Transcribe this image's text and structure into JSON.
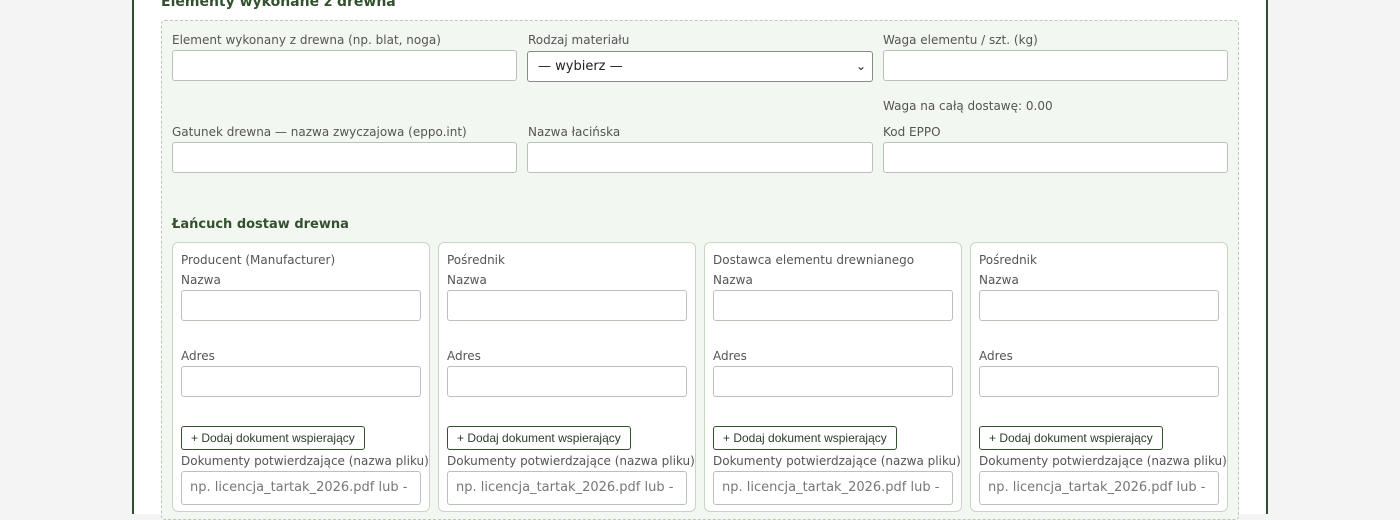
{
  "section": {
    "title": "Elementy wykonane z drewna"
  },
  "fields": {
    "element_label": "Element wykonany z drewna (np. blat, noga)",
    "element_value": "",
    "material_label": "Rodzaj materiału",
    "material_selected": "— wybierz —",
    "weight_label": "Waga elementu / szt. (kg)",
    "weight_value": "",
    "weight_total_note": "Waga na całą dostawę: 0.00",
    "species_label": "Gatunek drewna — nazwa zwyczajowa (eppo.int)",
    "species_value": "",
    "latin_label": "Nazwa łacińska",
    "latin_value": "",
    "eppo_label": "Kod EPPO",
    "eppo_value": ""
  },
  "chain": {
    "title": "Łańcuch dostaw drewna",
    "cards": [
      {
        "role": "Producent (Manufacturer)",
        "name_label": "Nazwa",
        "address_label": "Adres",
        "add_doc_label": "+ Dodaj dokument wspierający",
        "docs_label": "Dokumenty potwierdzające (nazwa pliku)",
        "docs_placeholder": "np. licencja_tartak_2026.pdf lub -"
      },
      {
        "role": "Pośrednik",
        "name_label": "Nazwa",
        "address_label": "Adres",
        "add_doc_label": "+ Dodaj dokument wspierający",
        "docs_label": "Dokumenty potwierdzające (nazwa pliku)",
        "docs_placeholder": "np. licencja_tartak_2026.pdf lub -"
      },
      {
        "role": "Dostawca elementu drewnianego",
        "name_label": "Nazwa",
        "address_label": "Adres",
        "add_doc_label": "+ Dodaj dokument wspierający",
        "docs_label": "Dokumenty potwierdzające (nazwa pliku)",
        "docs_placeholder": "np. licencja_tartak_2026.pdf lub -"
      },
      {
        "role": "Pośrednik",
        "name_label": "Nazwa",
        "address_label": "Adres",
        "add_doc_label": "+ Dodaj dokument wspierający",
        "docs_label": "Dokumenty potwierdzające (nazwa pliku)",
        "docs_placeholder": "np. licencja_tartak_2026.pdf lub -"
      }
    ]
  },
  "colors": {
    "accent": "#33502f",
    "panel_bg": "#f3f7f1",
    "card_border": "#c9d5c4"
  },
  "icons": {
    "select_chevron": "chevron-down-icon"
  }
}
